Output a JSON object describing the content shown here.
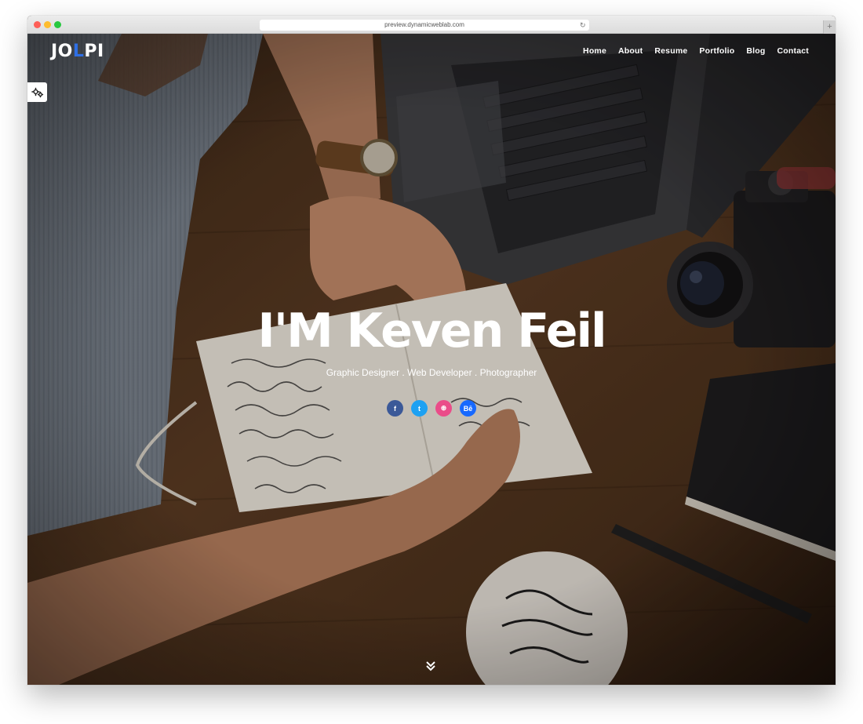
{
  "browser": {
    "url": "preview.dynamicweblab.com",
    "reload_icon": "reload-icon",
    "new_tab_label": "+"
  },
  "header": {
    "logo_main": "JO",
    "logo_accent": "L",
    "logo_rest": "PI",
    "nav": [
      "Home",
      "About",
      "Resume",
      "Portfolio",
      "Blog",
      "Contact"
    ]
  },
  "hero": {
    "title": "I'M Keven Feil",
    "subtitle": "Graphic Designer . Web Developer . Photographer",
    "social": [
      {
        "icon": "facebook-icon",
        "label": "f",
        "color": "#3b5998"
      },
      {
        "icon": "twitter-icon",
        "label": "t",
        "color": "#1da1f2"
      },
      {
        "icon": "dribbble-icon",
        "label": "⊛",
        "color": "#ea4c89"
      },
      {
        "icon": "behance-icon",
        "label": "Bē",
        "color": "#1769ff"
      }
    ]
  },
  "colors": {
    "accent": "#2f6fe4"
  }
}
